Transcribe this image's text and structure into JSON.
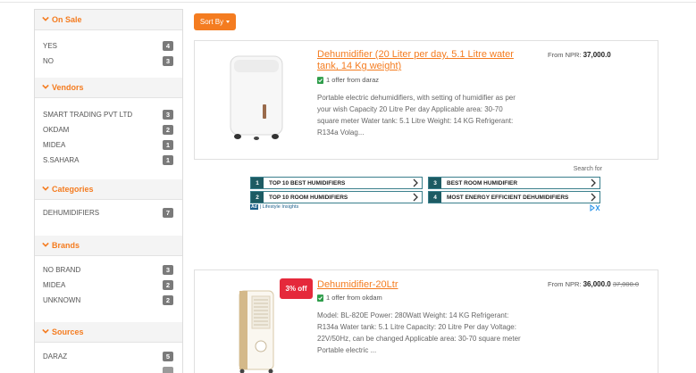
{
  "sidebar": {
    "facets": [
      {
        "title": "On Sale",
        "items": [
          {
            "label": "YES",
            "count": "4"
          },
          {
            "label": "NO",
            "count": "3"
          }
        ]
      },
      {
        "title": "Vendors",
        "items": [
          {
            "label": "SMART TRADING PVT LTD",
            "count": "3"
          },
          {
            "label": "OKDAM",
            "count": "2"
          },
          {
            "label": "MIDEA",
            "count": "1"
          },
          {
            "label": "S.SAHARA",
            "count": "1"
          }
        ]
      },
      {
        "title": "Categories",
        "items": [
          {
            "label": "DEHUMIDIFIERS",
            "count": "7"
          }
        ]
      },
      {
        "title": "Brands",
        "items": [
          {
            "label": "NO BRAND",
            "count": "3"
          },
          {
            "label": "MIDEA",
            "count": "2"
          },
          {
            "label": "UNKNOWN",
            "count": "2"
          }
        ]
      },
      {
        "title": "Sources",
        "items": [
          {
            "label": "DARAZ",
            "count": "5"
          }
        ]
      }
    ]
  },
  "toolbar": {
    "sort_label": "Sort By"
  },
  "products": [
    {
      "title_line1": "Dehumidifier (20 Liter per day, 5.1 Litre water",
      "title_line2": "tank, 14 Kg weight)",
      "offer": "1 offer from daraz",
      "desc_lines": [
        "Portable electric dehumidifiers, with setting of humidifier as per",
        "your wish Capacity 20 Litre Per day Applicable area: 30-70",
        "square meter Water tank: 5.1 Litre Weight: 14 KG Refrigerant:",
        "R134a Volag..."
      ],
      "price_prefix": "From NPR: ",
      "price": "37,000.0"
    },
    {
      "title_line1": "Dehumidifier-20Ltr",
      "discount": "3% off",
      "offer": "1 offer from okdam",
      "desc_lines": [
        "Model: BL-820E Power: 280Watt Weight: 14 KG Refrigerant:",
        "R134a Water tank: 5.1 Litre Capacity: 20 Litre Per day Voltage:",
        "22V/50Hz, can be changed Applicable area: 30-70 square meter",
        "Portable electric ..."
      ],
      "price_prefix": "From NPR: ",
      "price": "36,000.0",
      "old_price": "37,000.0"
    }
  ],
  "ad": {
    "search_for": "Search for",
    "rows": [
      {
        "num": "1",
        "text": "TOP 10 BEST HUMIDIFIERS"
      },
      {
        "num": "3",
        "text": "BEST ROOM HUMIDIFIER"
      },
      {
        "num": "2",
        "text": "TOP 10 ROOM HUMIDIFIERS"
      },
      {
        "num": "4",
        "text": "MOST ENERGY EFFICIENT DEHUMIDIFIERS"
      }
    ],
    "badge": "Ad",
    "footer": "| Lifestyle Insights"
  },
  "colors": {
    "accent": "#f47c20",
    "discount": "#e5293b",
    "ad_border": "#3a7f8c",
    "ad_num": "#1d5b63"
  },
  "icons": [
    "chevron-down-icon",
    "verified-check-icon",
    "chevron-right-icon",
    "ad-choices-icon"
  ]
}
